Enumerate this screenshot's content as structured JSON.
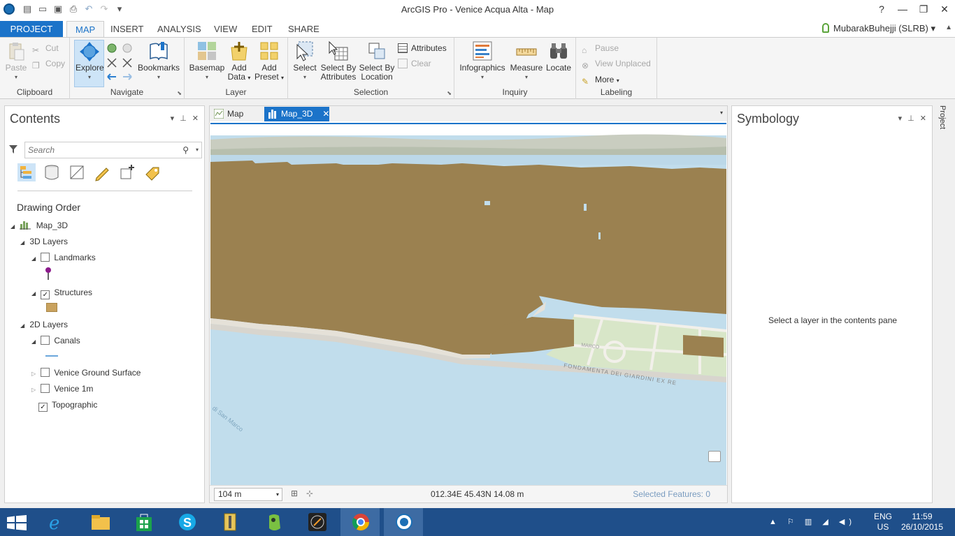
{
  "window": {
    "title": "ArcGIS Pro - Venice Acqua Alta - Map",
    "controls": [
      "?",
      "—",
      "❐",
      "✕"
    ]
  },
  "ribbon_tabs": [
    "PROJECT",
    "MAP",
    "INSERT",
    "ANALYSIS",
    "VIEW",
    "EDIT",
    "SHARE"
  ],
  "active_tab": "MAP",
  "user": "MubarakBuhejji (SLRB)",
  "ribbon": {
    "clipboard": {
      "label": "Clipboard",
      "paste": "Paste",
      "cut": "Cut",
      "copy": "Copy"
    },
    "navigate": {
      "label": "Navigate",
      "explore": "Explore",
      "bookmarks": "Bookmarks"
    },
    "layer": {
      "label": "Layer",
      "basemap": "Basemap",
      "add_data_1": "Add",
      "add_data_2": "Data",
      "add_preset_1": "Add",
      "add_preset_2": "Preset"
    },
    "selection": {
      "label": "Selection",
      "select": "Select",
      "sba_1": "Select By",
      "sba_2": "Attributes",
      "sbl_1": "Select By",
      "sbl_2": "Location",
      "attributes": "Attributes",
      "clear": "Clear"
    },
    "inquiry": {
      "label": "Inquiry",
      "infographics": "Infographics",
      "measure": "Measure",
      "locate": "Locate"
    },
    "labeling": {
      "label": "Labeling",
      "pause": "Pause",
      "view_unplaced": "View Unplaced",
      "more": "More"
    }
  },
  "contents": {
    "title": "Contents",
    "search_placeholder": "Search",
    "drawing_order": "Drawing Order",
    "map_name": "Map_3D",
    "group_3d": "3D Layers",
    "landmarks": "Landmarks",
    "structures": "Structures",
    "group_2d": "2D Layers",
    "canals": "Canals",
    "ground_surface": "Venice Ground Surface",
    "venice_1m": "Venice 1m",
    "topographic": "Topographic",
    "checked": {
      "landmarks": false,
      "structures": true,
      "canals": false,
      "ground_surface": false,
      "venice_1m": false,
      "topographic": true
    }
  },
  "map_tabs": [
    {
      "label": "Map"
    },
    {
      "label": "Map_3D"
    }
  ],
  "map_labels": {
    "street1": "FONDAMENTA DEI GIARDINI EX RE",
    "street2": "MARCO",
    "water": "di San Marco"
  },
  "status": {
    "scale": "104 m",
    "coords": "012.34E 45.43N   14.08 m",
    "selected": "Selected Features: 0"
  },
  "symbology": {
    "title": "Symbology",
    "message": "Select a layer in the contents pane"
  },
  "side_tab": "Project",
  "taskbar": {
    "lang_1": "ENG",
    "lang_2": "US",
    "time": "11:59",
    "date": "26/10/2015"
  },
  "colors": {
    "accent": "#1b73c9",
    "buildings": "#9b8150",
    "water": "#c1ddec",
    "park": "#d8e6c8"
  }
}
